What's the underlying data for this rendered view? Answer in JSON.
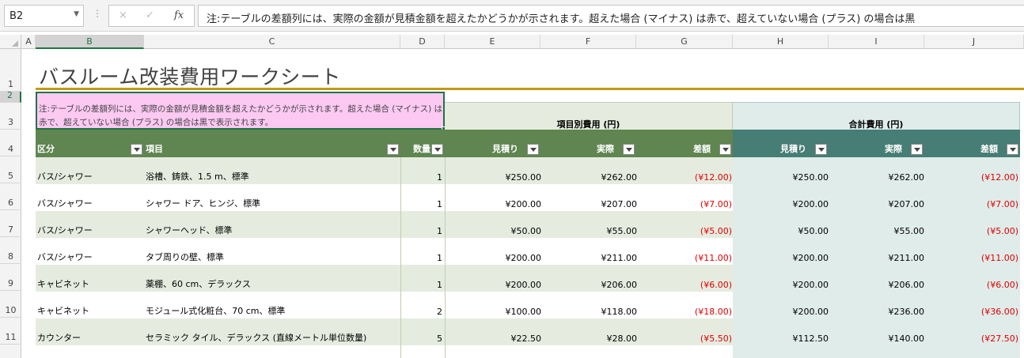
{
  "formula_bar": {
    "name_box": "B2",
    "cancel_icon": "×",
    "enter_icon": "✓",
    "function_icon": "fx",
    "content": "注:テーブルの差額列には、実際の金額が見積金額を超えたかどうかが示されます。超えた場合 (マイナス) は赤で、超えていない場合 (プラス) の場合は黒"
  },
  "columns": [
    "A",
    "B",
    "C",
    "D",
    "E",
    "F",
    "G",
    "H",
    "I",
    "J"
  ],
  "rows": [
    "1",
    "2",
    "3",
    "4",
    "5",
    "6",
    "7",
    "8",
    "9",
    "10",
    "11"
  ],
  "sheet": {
    "title": "バスルーム改装費用ワークシート",
    "note_line1": "注:テーブルの差額列には、実際の金額が見積金額を超えたかどうかが示されます。超えた場合 (マイナス) は",
    "note_line2": "赤で、超えていない場合 (プラス) の場合は黒で表示されます。",
    "group_item": "項目別費用 (円)",
    "group_total": "合計費用 (円)",
    "headers": {
      "category": "区分",
      "item": "項目",
      "qty": "数量",
      "est": "見積り",
      "act": "実際",
      "diff": "差額",
      "t_est": "見積り",
      "t_act": "実際",
      "t_diff": "差額"
    },
    "data": [
      {
        "category": "バス/シャワー",
        "item": "浴槽、鋳鉄、1.5 m、標準",
        "qty": "1",
        "est": "¥250.00",
        "act": "¥262.00",
        "diff": "(¥12.00)",
        "t_est": "¥250.00",
        "t_act": "¥262.00",
        "t_diff": "(¥12.00)"
      },
      {
        "category": "バス/シャワー",
        "item": "シャワー ドア、ヒンジ、標準",
        "qty": "1",
        "est": "¥200.00",
        "act": "¥207.00",
        "diff": "(¥7.00)",
        "t_est": "¥200.00",
        "t_act": "¥207.00",
        "t_diff": "(¥7.00)"
      },
      {
        "category": "バス/シャワー",
        "item": "シャワーヘッド、標準",
        "qty": "1",
        "est": "¥50.00",
        "act": "¥55.00",
        "diff": "(¥5.00)",
        "t_est": "¥50.00",
        "t_act": "¥55.00",
        "t_diff": "(¥5.00)"
      },
      {
        "category": "バス/シャワー",
        "item": "タブ周りの壁、標準",
        "qty": "1",
        "est": "¥200.00",
        "act": "¥211.00",
        "diff": "(¥11.00)",
        "t_est": "¥200.00",
        "t_act": "¥211.00",
        "t_diff": "(¥11.00)"
      },
      {
        "category": "キャビネット",
        "item": "薬棚、60 cm、デラックス",
        "qty": "1",
        "est": "¥200.00",
        "act": "¥206.00",
        "diff": "(¥6.00)",
        "t_est": "¥200.00",
        "t_act": "¥206.00",
        "t_diff": "(¥6.00)"
      },
      {
        "category": "キャビネット",
        "item": "モジュール式化粧台、70 cm、標準",
        "qty": "2",
        "est": "¥100.00",
        "act": "¥118.00",
        "diff": "(¥18.00)",
        "t_est": "¥200.00",
        "t_act": "¥236.00",
        "t_diff": "(¥36.00)"
      },
      {
        "category": "カウンター",
        "item": "セラミック タイル、デラックス (直線メートル単位数量)",
        "qty": "5",
        "est": "¥22.50",
        "act": "¥28.00",
        "diff": "(¥5.50)",
        "t_est": "¥112.50",
        "t_act": "¥140.00",
        "t_diff": "(¥27.50)"
      }
    ]
  },
  "colors": {
    "accent": "#217346",
    "title_rule": "#c39a13",
    "note_fill": "#fcc9f3",
    "header_green": "#5f8550",
    "header_teal": "#467d74",
    "negative": "#e00000"
  }
}
